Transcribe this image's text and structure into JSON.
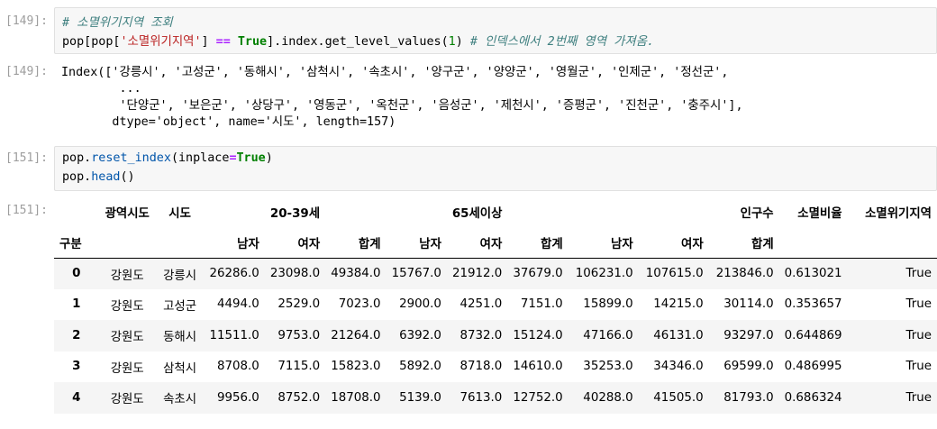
{
  "cells": [
    {
      "prompt": "[149]:",
      "code_line1": "# 소멸위기지역 조회",
      "code_line2": {
        "a": "pop[pop[",
        "str": "'소멸위기지역'",
        "b": "] ",
        "op": "==",
        "c": " ",
        "kw": "True",
        "d": "].index.get_level_values(",
        "num": "1",
        "e": ") ",
        "comment": "# 인덱스에서 2번째 영역 가져옴."
      }
    },
    {
      "prompt": "[149]:",
      "output_lines": [
        "Index(['강릉시', '고성군', '동해시', '삼척시', '속초시', '양구군', '양양군', '영월군', '인제군', '정선군',",
        "        ...",
        "        '단양군', '보은군', '상당구', '영동군', '옥천군', '음성군', '제천시', '증평군', '진천군', '충주시'],",
        "       dtype='object', name='시도', length=157)"
      ]
    },
    {
      "prompt": "[151]:",
      "line1": {
        "a": "pop.",
        "fn": "reset_index",
        "b": "(inplace",
        "op": "=",
        "kw": "True",
        "c": ")"
      },
      "line2": {
        "a": "pop.",
        "fn": "head",
        "b": "()"
      }
    },
    {
      "prompt": "[151]:"
    }
  ],
  "table": {
    "header1": {
      "blank": "",
      "col_province": "광역시도",
      "col_city": "시도",
      "group_2039": "20-39세",
      "group_65": "65세이상",
      "col_pop": "인구수",
      "col_ratio": "소멸비율",
      "col_risk": "소멸위기지역"
    },
    "header2": {
      "index_name": "구분",
      "male1": "남자",
      "female1": "여자",
      "sum1": "합계",
      "male2": "남자",
      "female2": "여자",
      "sum2": "합계",
      "male3": "남자",
      "female3": "여자",
      "sum3": "합계"
    },
    "rows": [
      [
        "0",
        "강원도",
        "강릉시",
        "26286.0",
        "23098.0",
        "49384.0",
        "15767.0",
        "21912.0",
        "37679.0",
        "106231.0",
        "107615.0",
        "213846.0",
        "0.613021",
        "True"
      ],
      [
        "1",
        "강원도",
        "고성군",
        "4494.0",
        "2529.0",
        "7023.0",
        "2900.0",
        "4251.0",
        "7151.0",
        "15899.0",
        "14215.0",
        "30114.0",
        "0.353657",
        "True"
      ],
      [
        "2",
        "강원도",
        "동해시",
        "11511.0",
        "9753.0",
        "21264.0",
        "6392.0",
        "8732.0",
        "15124.0",
        "47166.0",
        "46131.0",
        "93297.0",
        "0.644869",
        "True"
      ],
      [
        "3",
        "강원도",
        "삼척시",
        "8708.0",
        "7115.0",
        "15823.0",
        "5892.0",
        "8718.0",
        "14610.0",
        "35253.0",
        "34346.0",
        "69599.0",
        "0.486995",
        "True"
      ],
      [
        "4",
        "강원도",
        "속초시",
        "9956.0",
        "8752.0",
        "18708.0",
        "5139.0",
        "7613.0",
        "12752.0",
        "40288.0",
        "41505.0",
        "81793.0",
        "0.686324",
        "True"
      ]
    ]
  }
}
